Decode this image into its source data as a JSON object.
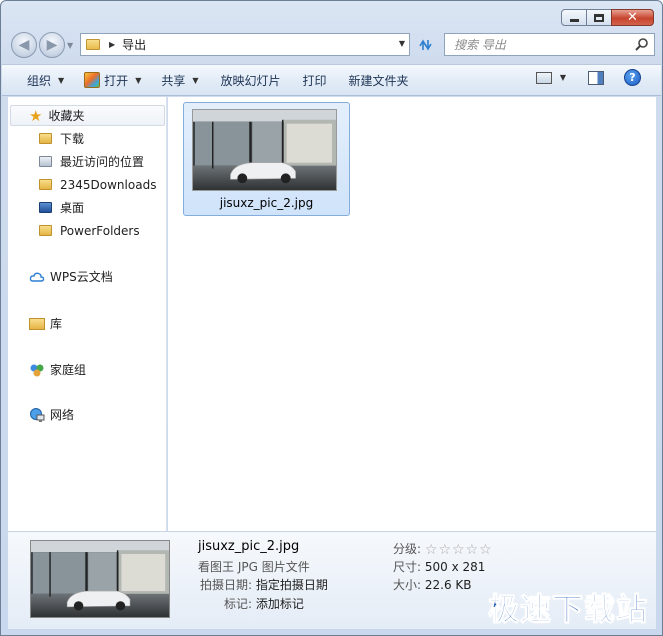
{
  "window": {
    "caption_buttons": [
      "minimize",
      "maximize",
      "close"
    ]
  },
  "address_bar": {
    "path": [
      "导出"
    ]
  },
  "search": {
    "placeholder": "搜索 导出"
  },
  "toolbar": {
    "organize": "组织",
    "open": "打开",
    "share": "共享",
    "slideshow": "放映幻灯片",
    "print": "打印",
    "new_folder": "新建文件夹"
  },
  "nav": {
    "favorites": "收藏夹",
    "fav_items": [
      "下载",
      "最近访问的位置",
      "2345Downloads",
      "桌面",
      "PowerFolders"
    ],
    "wps": "WPS云文档",
    "library": "库",
    "homegroup": "家庭组",
    "network": "网络"
  },
  "files": [
    {
      "name": "jisuxz_pic_2.jpg"
    }
  ],
  "details": {
    "name": "jisuxz_pic_2.jpg",
    "type": "看图王 JPG 图片文件",
    "date_label": "拍摄日期:",
    "date_value": "指定拍摄日期",
    "tags_label": "标记:",
    "tags_value": "添加标记",
    "rating_label": "分级:",
    "rating_stars": 0,
    "size_label": "尺寸:",
    "size_value": "500 x 281",
    "bytes_label": "大小:",
    "bytes_value": "22.6 KB"
  },
  "watermark": "极速下载站",
  "colors": {
    "accent": "#1c57b5",
    "selection": "#cfe3fa"
  }
}
